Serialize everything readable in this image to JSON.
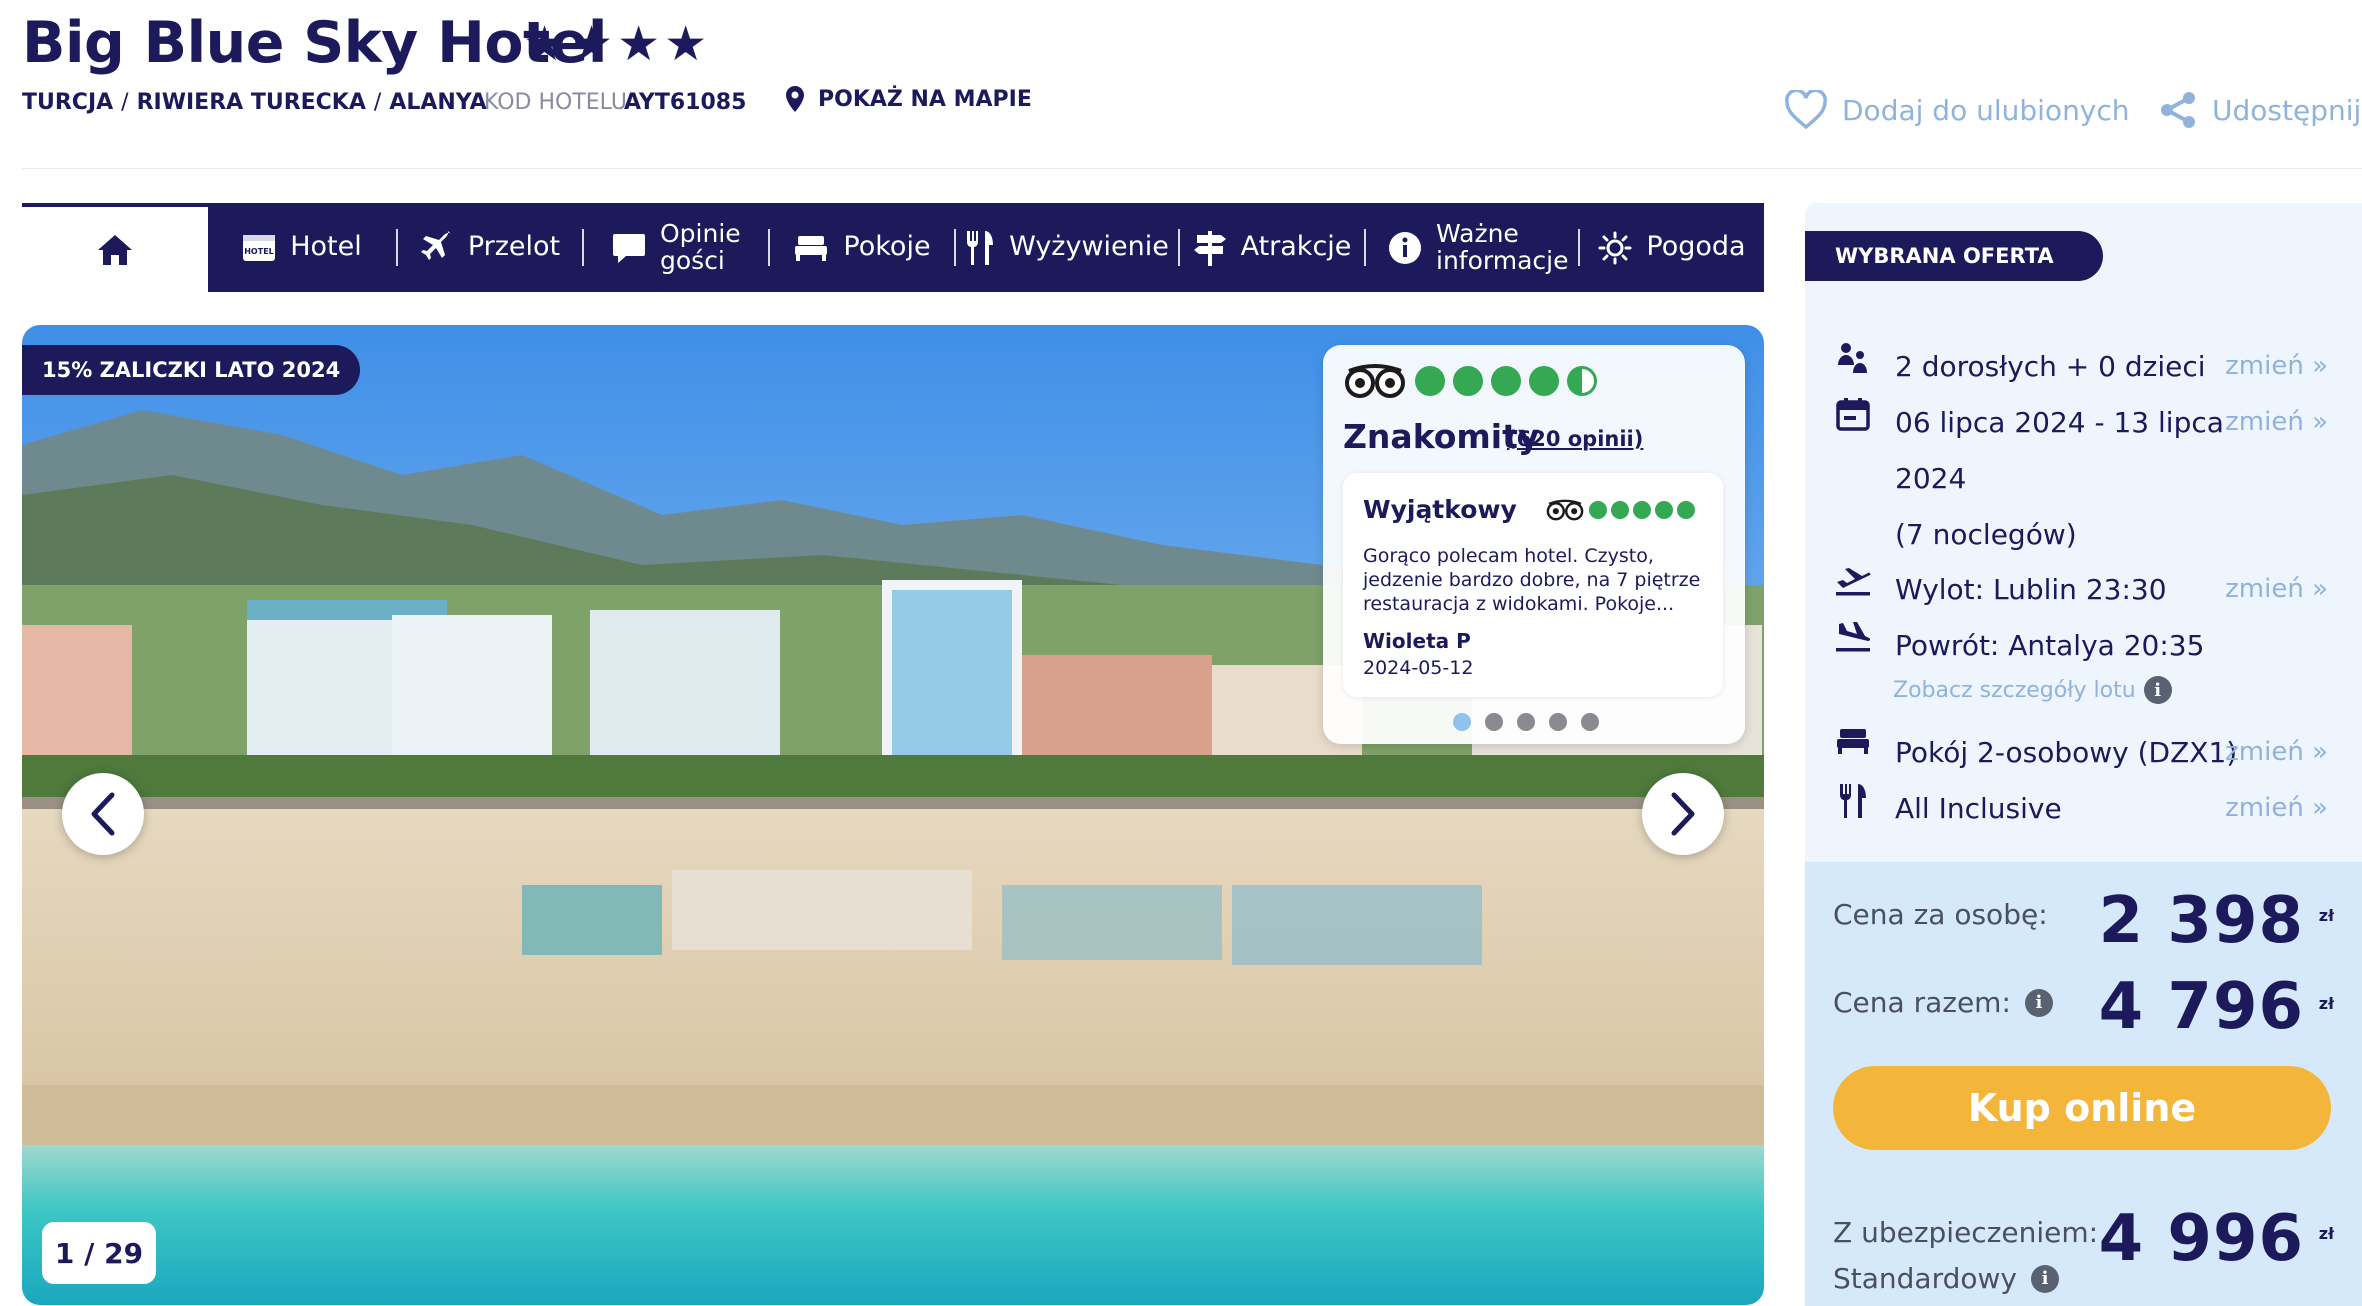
{
  "hotel": {
    "name": "Big Blue Sky Hotel",
    "stars": "★★★★",
    "breadcrumb": [
      "TURCJA",
      "RIWIERA TURECKA",
      "ALANYA"
    ],
    "breadcrumb_sep": "/",
    "code_label": "KOD HOTELU",
    "code_value": "AYT61085",
    "map_link": "POKAŻ NA MAPIE"
  },
  "actions": {
    "favorite": "Dodaj do ulubionych",
    "share": "Udostępnij"
  },
  "nav": {
    "items": [
      {
        "label": "",
        "icon": "home-icon"
      },
      {
        "label": "Hotel",
        "icon": "hotel-icon"
      },
      {
        "label": "Przelot",
        "icon": "plane-icon"
      },
      {
        "label": "Opinie gości",
        "icon": "chat-icon"
      },
      {
        "label": "Pokoje",
        "icon": "bed-icon"
      },
      {
        "label": "Wyżywienie",
        "icon": "cutlery-icon"
      },
      {
        "label": "Atrakcje",
        "icon": "signpost-icon"
      },
      {
        "label": "Ważne informacje",
        "icon": "info-icon"
      },
      {
        "label": "Pogoda",
        "icon": "sun-icon"
      }
    ]
  },
  "gallery": {
    "badge": "15% ZALICZKI LATO 2024",
    "counter": "1 / 29"
  },
  "review": {
    "overall_word": "Znakomity",
    "count_text": "(620 opinii)",
    "overall_bubbles": 4.5,
    "item": {
      "title": "Wyjątkowy",
      "bubbles": 5,
      "text": "Gorąco polecam hotel. Czysto, jedzenie bardzo dobre, na 7 piętrze restauracja z widokami. Pokoje...",
      "author": "Wioleta P",
      "date": "2024-05-12"
    },
    "dots": 5,
    "active_dot": 1
  },
  "offer": {
    "badge": "WYBRANA OFERTA",
    "change_label": "zmień »",
    "travelers": "2 dorosłych + 0 dzieci",
    "dates_line1": "06 lipca 2024 - 13 lipca",
    "dates_line2": "2024",
    "nights": "(7 noclegów)",
    "departure": "Wylot: Lublin 23:30",
    "return": "Powrót: Antalya 20:35",
    "flight_details": "Zobacz szczegóły lotu",
    "room": "Pokój 2-osobowy (DZX1)",
    "board": "All Inclusive"
  },
  "prices": {
    "per_person_label": "Cena za osobę:",
    "per_person": "2 398",
    "total_label": "Cena razem:",
    "total": "4 796",
    "currency": "zł",
    "buy_label": "Kup online",
    "insurance_label_1": "Z ubezpieczeniem:",
    "insurance_label_2": "Standardowy",
    "insurance_total": "4 996"
  },
  "colors": {
    "navy": "#1c1a5a",
    "link_blue": "#8fb3dc",
    "panel_bg": "#eef5fc",
    "price_bg": "#d6e9fb",
    "buy_button": "#f4b63a",
    "tripadvisor_green": "#34a853"
  }
}
